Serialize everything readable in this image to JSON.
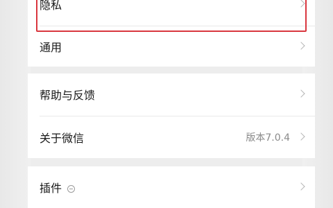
{
  "settings": {
    "group1": [
      {
        "label": "隐私"
      },
      {
        "label": "通用"
      }
    ],
    "group2": [
      {
        "label": "帮助与反馈"
      },
      {
        "label": "关于微信",
        "value": "版本7.0.4"
      }
    ],
    "group3": [
      {
        "label": "插件",
        "icon": "minus-circle-icon"
      }
    ]
  },
  "colors": {
    "highlight_border": "#d9363e",
    "background": "#ededed",
    "row_background": "#ffffff"
  }
}
